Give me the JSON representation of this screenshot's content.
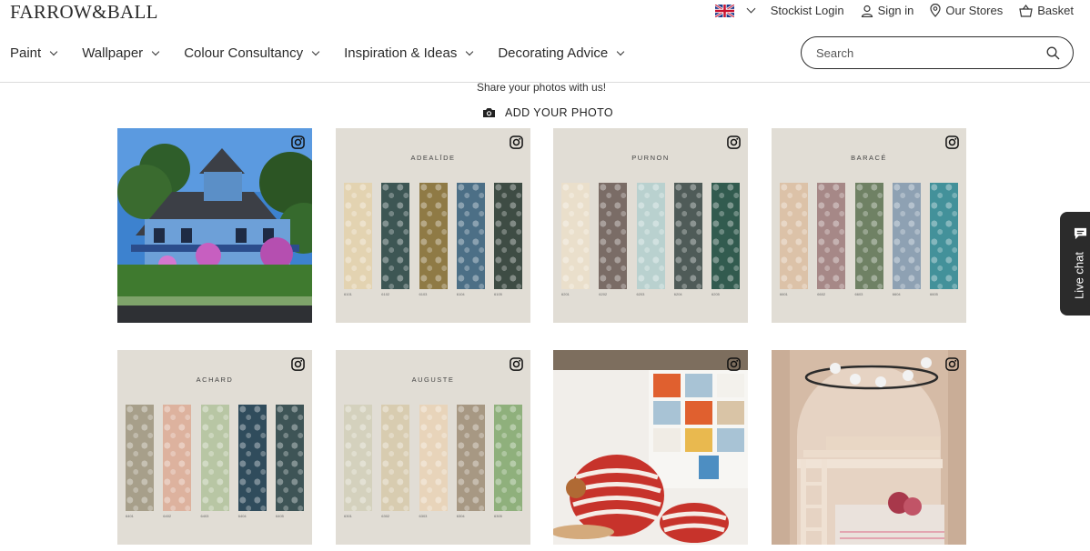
{
  "brand": {
    "logo_text": "FARROW&BALL"
  },
  "utility": {
    "country": "uk-flag-icon",
    "stockist_login": "Stockist Login",
    "sign_in": "Sign in",
    "our_stores": "Our Stores",
    "basket": "Basket"
  },
  "nav": {
    "items": [
      {
        "label": "Paint"
      },
      {
        "label": "Wallpaper"
      },
      {
        "label": "Colour Consultancy"
      },
      {
        "label": "Inspiration & Ideas"
      },
      {
        "label": "Decorating Advice"
      }
    ]
  },
  "search": {
    "placeholder": "Search"
  },
  "share": {
    "title": "Share your photos with us!",
    "add_photo_label": "ADD YOUR PHOTO"
  },
  "gallery": {
    "tiles": [
      {
        "type": "photo",
        "subject": "blue-victorian-house"
      },
      {
        "type": "pattern",
        "title": "ADEALĪDE",
        "swatches": [
          "#e3d3b1",
          "#3d5654",
          "#8f7a45",
          "#4c6f86",
          "#3e4c44"
        ],
        "codes": [
          "6101",
          "6102",
          "6103",
          "6104",
          "6105"
        ]
      },
      {
        "type": "pattern",
        "title": "PURNON",
        "swatches": [
          "#eadfcb",
          "#7a6c66",
          "#b9d1cf",
          "#4f5b58",
          "#325b4f"
        ],
        "codes": [
          "6201",
          "6202",
          "6203",
          "6204",
          "6205"
        ]
      },
      {
        "type": "pattern",
        "title": "BARACÉ",
        "swatches": [
          "#dcc2a8",
          "#a68887",
          "#6f8164",
          "#8ea1b3",
          "#43919a"
        ],
        "codes": [
          "6601",
          "6602",
          "6603",
          "6604",
          "6605"
        ]
      },
      {
        "type": "pattern",
        "title": "ACHARD",
        "swatches": [
          "#a79f8a",
          "#ddb29e",
          "#b8c6a4",
          "#304c5c",
          "#3e5456"
        ],
        "codes": [
          "6401",
          "6402",
          "6403",
          "6404",
          "6405"
        ]
      },
      {
        "type": "pattern",
        "title": "AUGUSTE",
        "swatches": [
          "#d4d1bd",
          "#d8ccb0",
          "#e8d4ba",
          "#a79883",
          "#8fb07c"
        ],
        "codes": [
          "6301",
          "6302",
          "6303",
          "6304",
          "6305"
        ]
      },
      {
        "type": "photo",
        "subject": "kids-room-red-striped-chair"
      },
      {
        "type": "photo",
        "subject": "arched-bunk-bed-nook"
      }
    ]
  },
  "live_chat": {
    "label": "Live chat"
  }
}
